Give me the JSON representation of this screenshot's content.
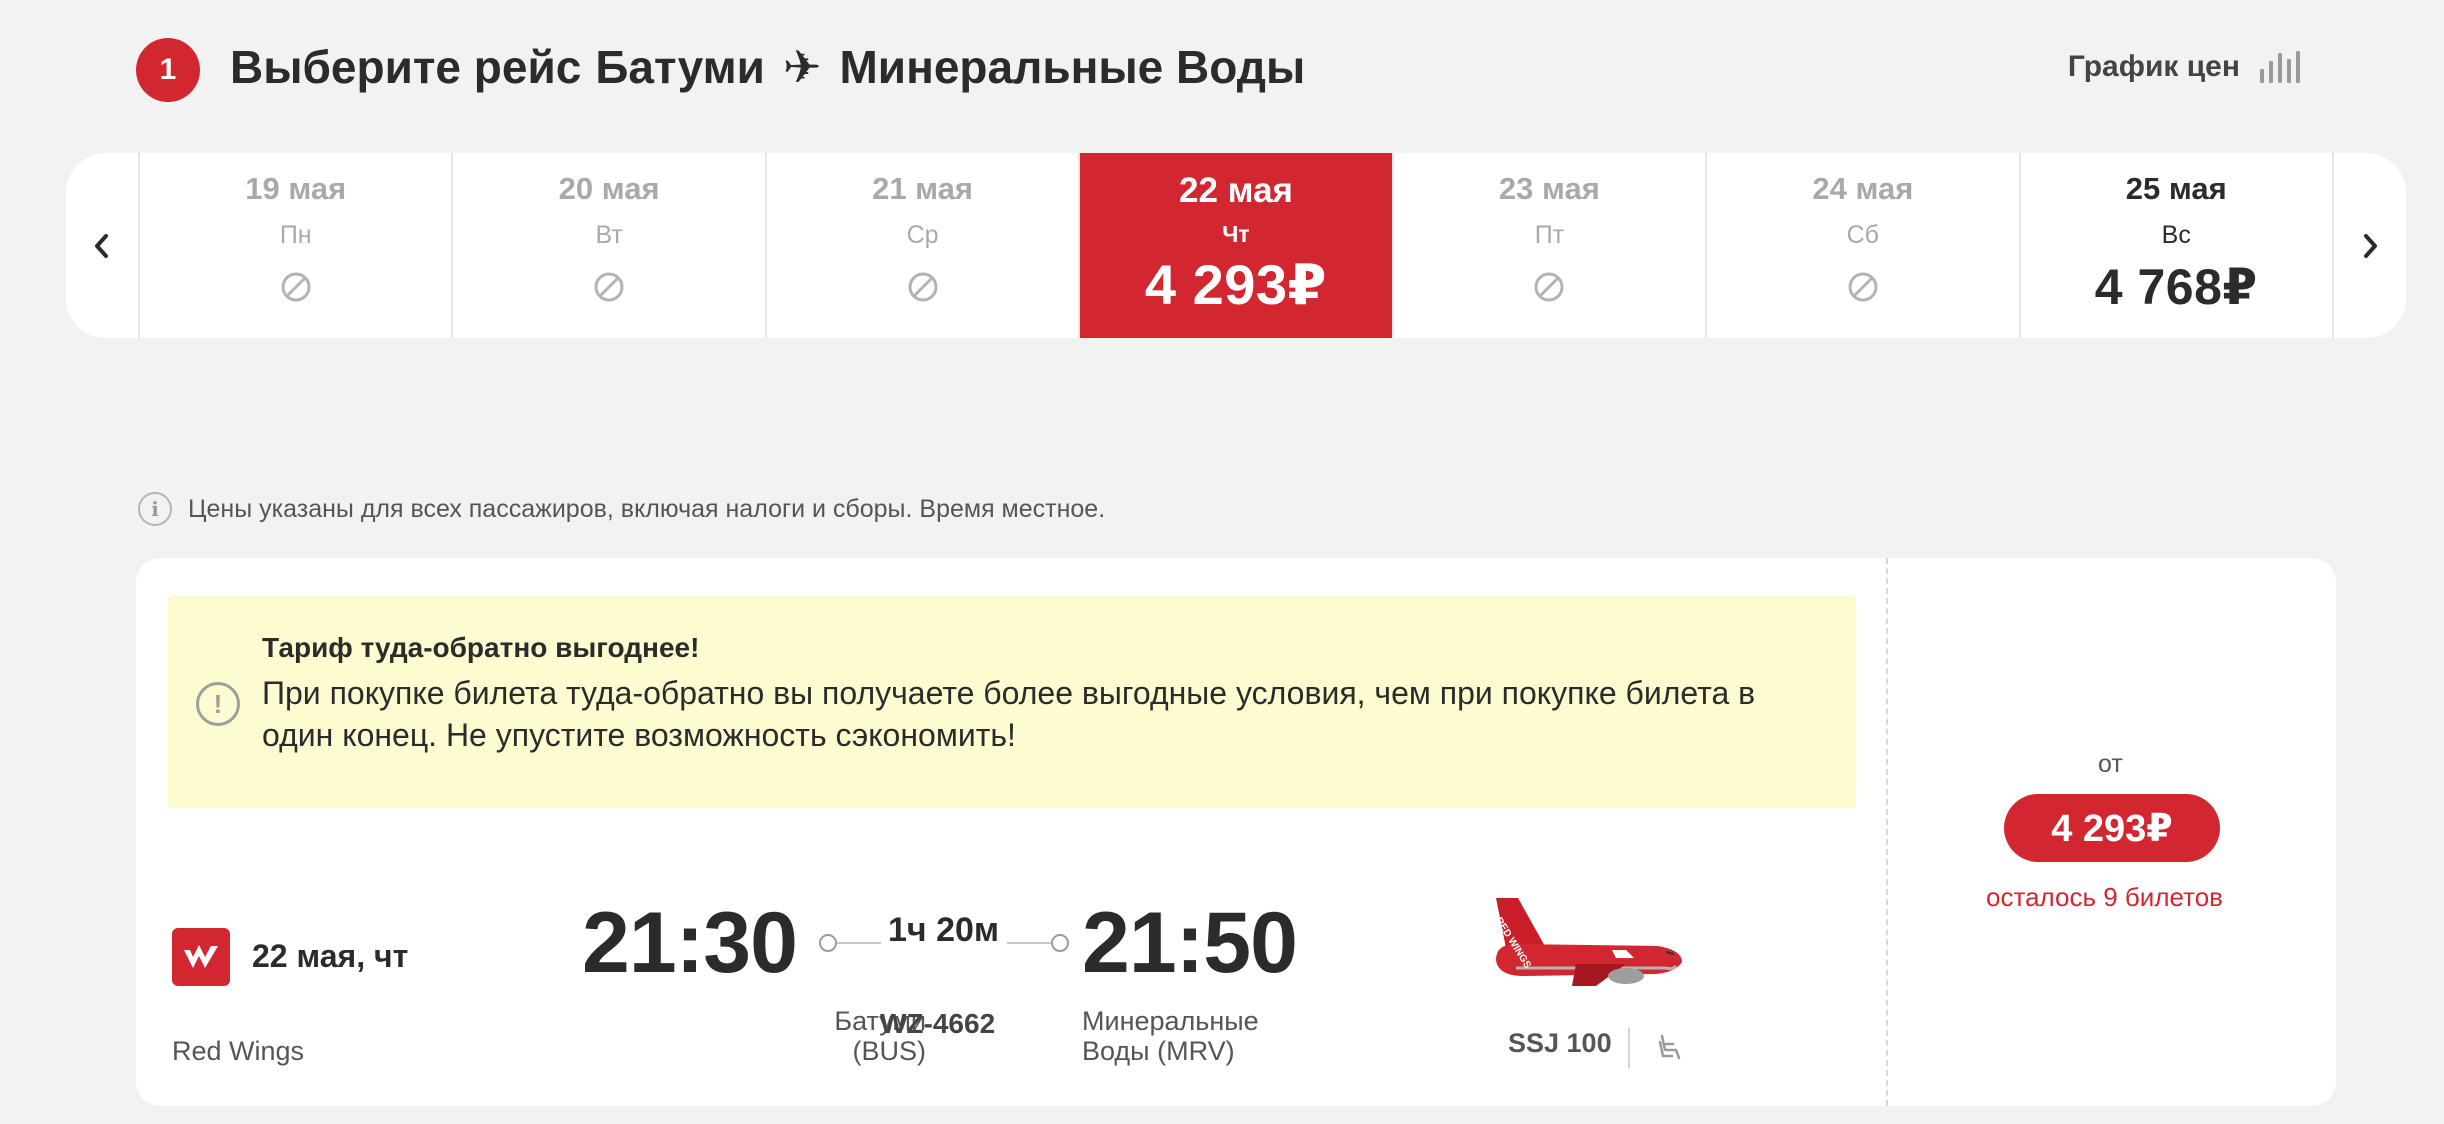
{
  "header": {
    "step_number": "1",
    "title_prefix": "Выберите рейс",
    "origin": "Батуми",
    "destination": "Минеральные Воды",
    "price_chart_label": "График цен"
  },
  "date_strip": {
    "days": [
      {
        "date": "19 мая",
        "weekday": "Пн",
        "price": "",
        "status": "unavailable"
      },
      {
        "date": "20 мая",
        "weekday": "Вт",
        "price": "",
        "status": "unavailable"
      },
      {
        "date": "21 мая",
        "weekday": "Ср",
        "price": "",
        "status": "unavailable"
      },
      {
        "date": "22 мая",
        "weekday": "Чт",
        "price": "4 293₽",
        "status": "selected"
      },
      {
        "date": "23 мая",
        "weekday": "Пт",
        "price": "",
        "status": "unavailable"
      },
      {
        "date": "24 мая",
        "weekday": "Сб",
        "price": "",
        "status": "unavailable"
      },
      {
        "date": "25 мая",
        "weekday": "Вс",
        "price": "4 768₽",
        "status": "available"
      }
    ]
  },
  "info_note": "Цены указаны для всех пассажиров, включая налоги и сборы. Время местное.",
  "promo": {
    "title": "Тариф туда-обратно выгоднее!",
    "text": "При покупке билета туда-обратно вы получаете более выгодные условия, чем при покупке билета в один конец. Не упустите возможность сэкономить!"
  },
  "flight": {
    "date": "22 мая, чт",
    "airline": "Red Wings",
    "departure_time": "21:30",
    "arrival_time": "21:50",
    "duration": "1ч 20м",
    "departure_city_line1": "Батуми",
    "departure_city_line2": "(BUS)",
    "flight_number": "WZ-4662",
    "arrival_city_line1": "Минеральные",
    "arrival_city_line2": "Воды (MRV)",
    "aircraft": "SSJ 100",
    "aircraft_livery_text": "RED WINGS"
  },
  "price_box": {
    "from_label": "от",
    "price": "4 293₽",
    "seats_left": "осталось 9 билетов"
  },
  "colors": {
    "accent": "#d22730",
    "background": "#f2f2f2",
    "promo_background": "#fdfcd0"
  }
}
